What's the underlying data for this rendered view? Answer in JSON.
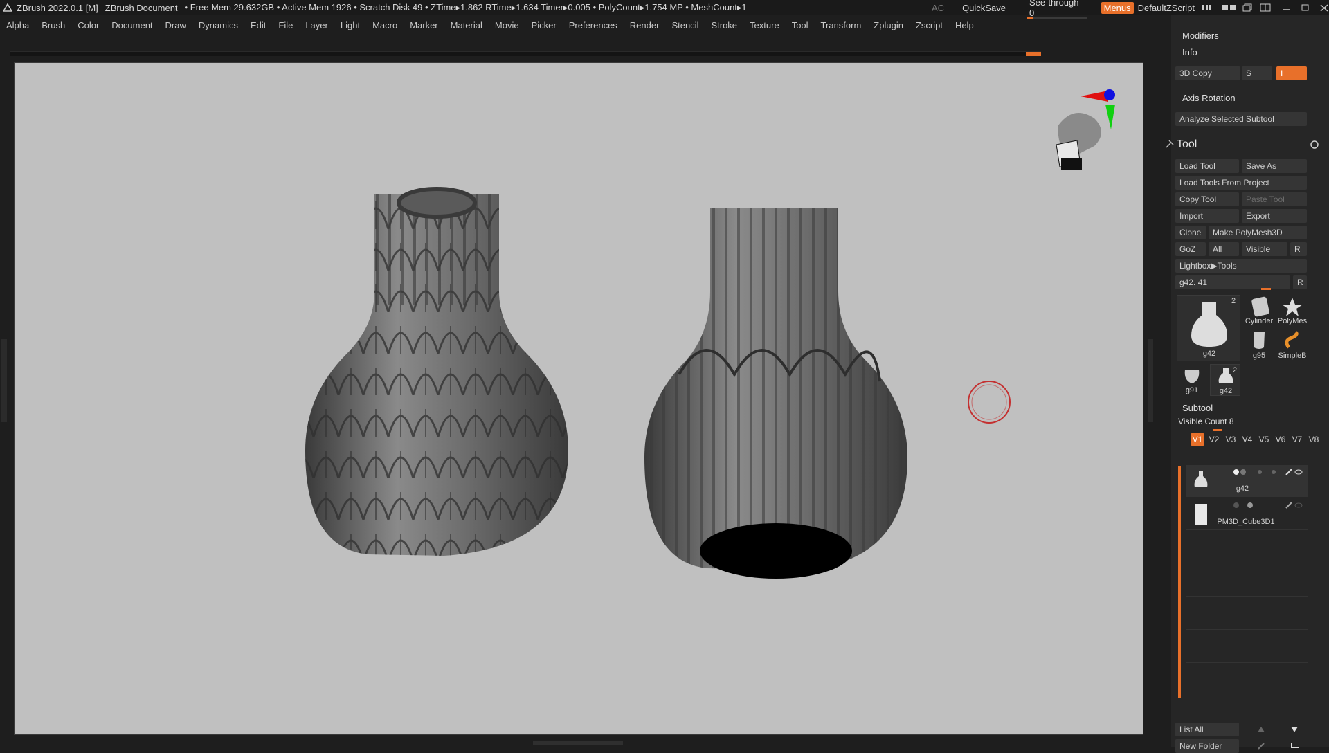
{
  "titlebar": {
    "app": "ZBrush 2022.0.1 [M]",
    "document": "ZBrush Document",
    "stats": "• Free Mem 29.632GB • Active Mem 1926 • Scratch Disk 49 • ZTime▸1.862 RTime▸1.634 Timer▸0.005 • PolyCount▸1.754 MP • MeshCount▸1",
    "ac": "AC",
    "quicksave": "QuickSave",
    "see_through_label": "See-through",
    "see_through_value": "0",
    "menus": "Menus",
    "script": "DefaultZScript"
  },
  "menubar": [
    "Alpha",
    "Brush",
    "Color",
    "Document",
    "Draw",
    "Dynamics",
    "Edit",
    "File",
    "Layer",
    "Light",
    "Macro",
    "Marker",
    "Material",
    "Movie",
    "Picker",
    "Preferences",
    "Render",
    "Stencil",
    "Stroke",
    "Texture",
    "Tool",
    "Transform",
    "Zplugin",
    "Zscript",
    "Help"
  ],
  "panel": {
    "modifiers": "Modifiers",
    "info": "Info",
    "copy3d": "3D Copy",
    "s_label": "S",
    "i_label": "I",
    "axis_rotation": "Axis Rotation",
    "analyze": "Analyze Selected Subtool",
    "tool_title": "Tool",
    "load_tool": "Load Tool",
    "save_as": "Save As",
    "load_from_project": "Load Tools From Project",
    "copy_tool": "Copy Tool",
    "paste_tool": "Paste Tool",
    "import": "Import",
    "export": "Export",
    "clone": "Clone",
    "make_polymesh": "Make PolyMesh3D",
    "goz": "GoZ",
    "all": "All",
    "visible": "Visible",
    "r": "R",
    "lightbox_tools": "Lightbox▶Tools",
    "tool_slider_label": "g42. 41",
    "thumbs": [
      {
        "name": "g42",
        "count": "2"
      },
      {
        "name": "Cylinder"
      },
      {
        "name": "PolyMes"
      },
      {
        "name": "g95"
      },
      {
        "name": "SimpleB"
      },
      {
        "name": "g91"
      },
      {
        "name": "g42",
        "count": "2"
      }
    ],
    "subtool_title": "Subtool",
    "visible_count_label": "Visible Count",
    "visible_count_value": "8",
    "vtabs": [
      "V1",
      "V2",
      "V3",
      "V4",
      "V5",
      "V6",
      "V7",
      "V8"
    ],
    "subtools": [
      "g42",
      "PM3D_Cube3D1"
    ],
    "list_all": "List All",
    "new_folder": "New Folder"
  },
  "colors": {
    "accent": "#e8702a",
    "canvas_bg": "#c0c0c0",
    "panel_bg": "#262626"
  }
}
